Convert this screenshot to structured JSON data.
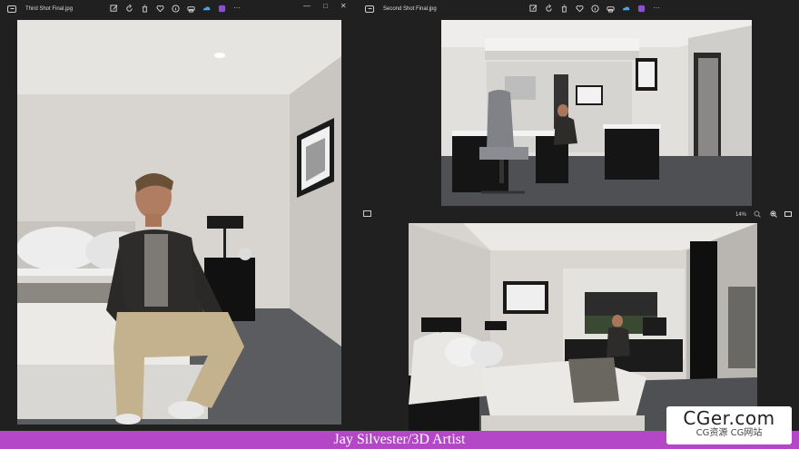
{
  "left_window": {
    "title": "Third Shot Final.jpg",
    "controls": {
      "minimize": "—",
      "maximize": "□",
      "close": "✕"
    },
    "toolbar": [
      "edit-icon",
      "rotate-icon",
      "delete-icon",
      "favorite-icon",
      "info-icon",
      "print-icon",
      "onedrive-icon",
      "clipchamp-icon",
      "more-icon"
    ]
  },
  "right_top_window": {
    "title": "Second Shot Final.jpg",
    "toolbar": [
      "edit-icon",
      "rotate-icon",
      "delete-icon",
      "favorite-icon",
      "info-icon",
      "print-icon",
      "onedrive-icon",
      "clipchamp-icon",
      "more-icon"
    ],
    "zoom": "14%"
  },
  "caption": "Jay Silvester/3D Artist",
  "watermark": {
    "main": "CGer.com",
    "sub": "CG资源  CG网站"
  },
  "colors": {
    "window_bg": "#202020",
    "caption_bg": "#b347c6",
    "wall": "#d9d6d2",
    "carpet": "#5a5b5e"
  }
}
